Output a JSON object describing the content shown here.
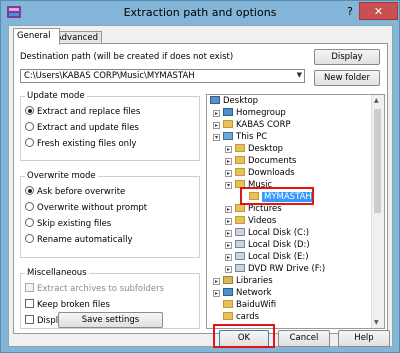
{
  "window": {
    "title": "Extraction path and options",
    "help_label": "?",
    "close_label": "✕"
  },
  "tabs": [
    {
      "label": "General",
      "selected": true
    },
    {
      "label": "Advanced",
      "selected": false
    }
  ],
  "destination": {
    "label": "Destination path (will be created if does not exist)",
    "value": "C:\\Users\\KABAS CORP\\Music\\MYMASTAH",
    "display_button": "Display",
    "new_folder_button": "New folder"
  },
  "update_mode": {
    "title": "Update mode",
    "options": [
      {
        "label": "Extract and replace files",
        "selected": true
      },
      {
        "label": "Extract and update files",
        "selected": false
      },
      {
        "label": "Fresh existing files only",
        "selected": false
      }
    ]
  },
  "overwrite_mode": {
    "title": "Overwrite mode",
    "options": [
      {
        "label": "Ask before overwrite",
        "selected": true
      },
      {
        "label": "Overwrite without prompt",
        "selected": false
      },
      {
        "label": "Skip existing files",
        "selected": false
      },
      {
        "label": "Rename automatically",
        "selected": false
      }
    ]
  },
  "misc": {
    "title": "Miscellaneous",
    "options": [
      {
        "label": "Extract archives to subfolders",
        "checked": false,
        "disabled": true
      },
      {
        "label": "Keep broken files",
        "checked": false,
        "disabled": false
      },
      {
        "label": "Display files in Explorer",
        "checked": false,
        "disabled": false
      }
    ],
    "save_button": "Save settings"
  },
  "tree": {
    "nodes": [
      {
        "label": "Desktop",
        "icon": "desktop-icon"
      },
      {
        "label": "Homegroup",
        "icon": "homegroup-icon"
      },
      {
        "label": "KABAS CORP",
        "icon": "user-folder-icon"
      },
      {
        "label": "This PC",
        "icon": "computer-icon"
      },
      {
        "label": "Desktop",
        "icon": "folder-icon"
      },
      {
        "label": "Documents",
        "icon": "folder-icon"
      },
      {
        "label": "Downloads",
        "icon": "folder-icon"
      },
      {
        "label": "Music",
        "icon": "folder-icon"
      },
      {
        "label": "MYMASTAH",
        "icon": "folder-icon",
        "selected": true
      },
      {
        "label": "Pictures",
        "icon": "folder-icon"
      },
      {
        "label": "Videos",
        "icon": "folder-icon"
      },
      {
        "label": "Local Disk (C:)",
        "icon": "drive-icon"
      },
      {
        "label": "Local Disk (D:)",
        "icon": "drive-icon"
      },
      {
        "label": "Local Disk (E:)",
        "icon": "drive-icon"
      },
      {
        "label": "DVD RW Drive (F:)",
        "icon": "dvd-drive-icon"
      },
      {
        "label": "Libraries",
        "icon": "library-icon"
      },
      {
        "label": "Network",
        "icon": "network-icon"
      },
      {
        "label": "BaiduWifi",
        "icon": "folder-icon"
      },
      {
        "label": "cards",
        "icon": "folder-icon"
      }
    ]
  },
  "footer": {
    "ok": "OK",
    "cancel": "Cancel",
    "help": "Help"
  },
  "colors": {
    "frame": "#83b5d8",
    "close": "#c75050",
    "highlight": "#e01515",
    "selection": "#3399ff"
  }
}
